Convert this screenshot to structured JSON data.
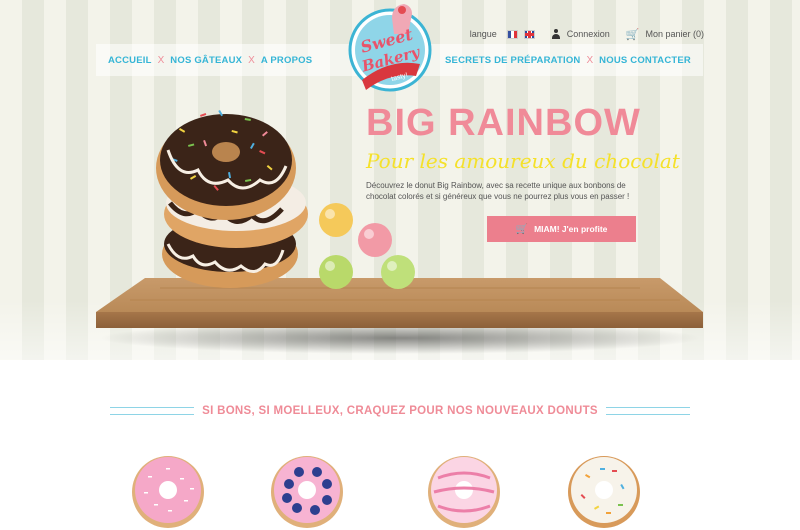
{
  "topbar": {
    "language_label": "langue",
    "login_label": "Connexion",
    "cart_label": "Mon panier (0)"
  },
  "nav": {
    "left": [
      "ACCUEIL",
      "NOS GÂTEAUX",
      "A PROPOS"
    ],
    "right": [
      "SECRETS DE PRÉPARATION",
      "NOUS CONTACTER"
    ],
    "separator": "X"
  },
  "logo": {
    "line1": "Sweet",
    "line2": "Bakery",
    "ribbon": "tasty!"
  },
  "hero": {
    "title": "BIG RAINBOW",
    "tagline": "Pour les amoureux du chocolat",
    "description": "Découvrez le donut Big Rainbow, avec sa recette unique aux bonbons de chocolat colorés et si généreux que vous ne pourrez plus vous en passer !",
    "cta_label": "MIAM! J'en profite"
  },
  "section": {
    "title": "SI BONS, SI MOELLEUX, CRAQUEZ POUR NOS NOUVEAUX DONUTS"
  },
  "products": [
    {
      "name": "pink-coconut-donut"
    },
    {
      "name": "pink-blueberry-donut"
    },
    {
      "name": "pink-striped-donut"
    },
    {
      "name": "sprinkles-donut"
    }
  ],
  "colors": {
    "pink": "#ef8b97",
    "blue": "#35b5d6",
    "yellow": "#f5e12a"
  },
  "icons": [
    "user-icon",
    "cart-icon",
    "flag-fr-icon",
    "flag-gb-icon"
  ]
}
